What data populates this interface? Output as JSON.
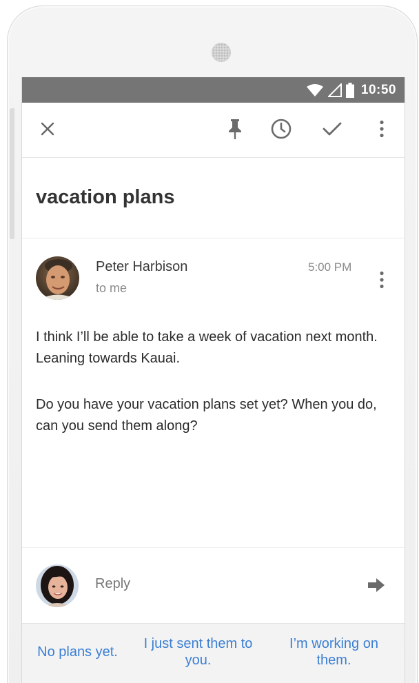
{
  "status_bar": {
    "time": "10:50",
    "icons": [
      "wifi-icon",
      "signal-icon",
      "battery-icon"
    ]
  },
  "toolbar": {
    "icons": [
      "close-icon",
      "pin-icon",
      "snooze-clock-icon",
      "check-done-icon",
      "more-vert-icon"
    ]
  },
  "email": {
    "subject": "vacation plans",
    "sender": "Peter Harbison",
    "recipient": "to me",
    "time": "5:00 PM",
    "body": [
      "I think I’ll be able to take a week of vacation next month. Leaning towards Kauai.",
      "Do you have your vacation plans set yet? When you do, can you send them along?"
    ]
  },
  "reply": {
    "placeholder": "Reply",
    "send_icon": "send-arrow-icon"
  },
  "smart_replies": [
    "No plans yet.",
    "I just sent them to you.",
    "I’m working on them."
  ],
  "colors": {
    "status_bar": "#757575",
    "smart_reply_text": "#3b7fd4",
    "smart_reply_bg": "#f3f3f3"
  }
}
